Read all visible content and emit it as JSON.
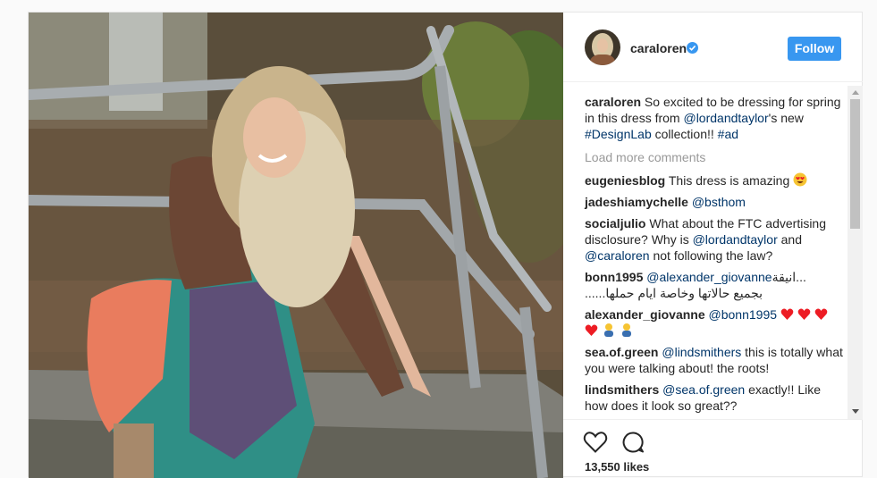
{
  "header": {
    "username": "caraloren",
    "follow_label": "Follow"
  },
  "caption": {
    "username": "caraloren",
    "text_1": " So excited to be dressing for spring in this dress from ",
    "mention": "@lordandtaylor",
    "text_2": "'s new ",
    "hashtag_1": "#DesignLab",
    "text_3": " collection!! ",
    "hashtag_2": "#ad"
  },
  "load_more_label": "Load more comments",
  "comments": [
    {
      "username": "eugeniesblog",
      "text": " This dress is amazing ",
      "emoji": "heart-eyes-icon"
    },
    {
      "username": "jadeshiamychelle",
      "mention": "@bsthom"
    },
    {
      "username": "socialjulio",
      "text_1": " What about the FTC advertising disclosure? Why is ",
      "mention_1": "@lordandtaylor",
      "text_2": " and ",
      "mention_2": "@caraloren",
      "text_3": " not following the law?"
    },
    {
      "username": "bonn1995",
      "mention": "@alexander_giovanne",
      "text_1": " ...انيقة",
      "text_2": "بجميع حالاتها وخاصة ايام حملها......"
    },
    {
      "username": "alexander_giovanne",
      "mention": "@bonn1995",
      "emojis": [
        "red-heart-icon",
        "red-heart-icon",
        "red-heart-icon",
        "red-heart-icon",
        "couple-icon",
        "couple-icon"
      ]
    },
    {
      "username": "sea.of.green",
      "mention": "@lindsmithers",
      "text": " this is totally what you were talking about! the roots!"
    },
    {
      "username": "lindsmithers",
      "mention": "@sea.of.green",
      "text": " exactly!! Like how does it look so great??"
    }
  ],
  "likes_label": "13,550 likes",
  "colors": {
    "link": "#003569",
    "follow_button": "#3897f0",
    "verified": "#3897f0",
    "heart": "#ed1c24"
  }
}
